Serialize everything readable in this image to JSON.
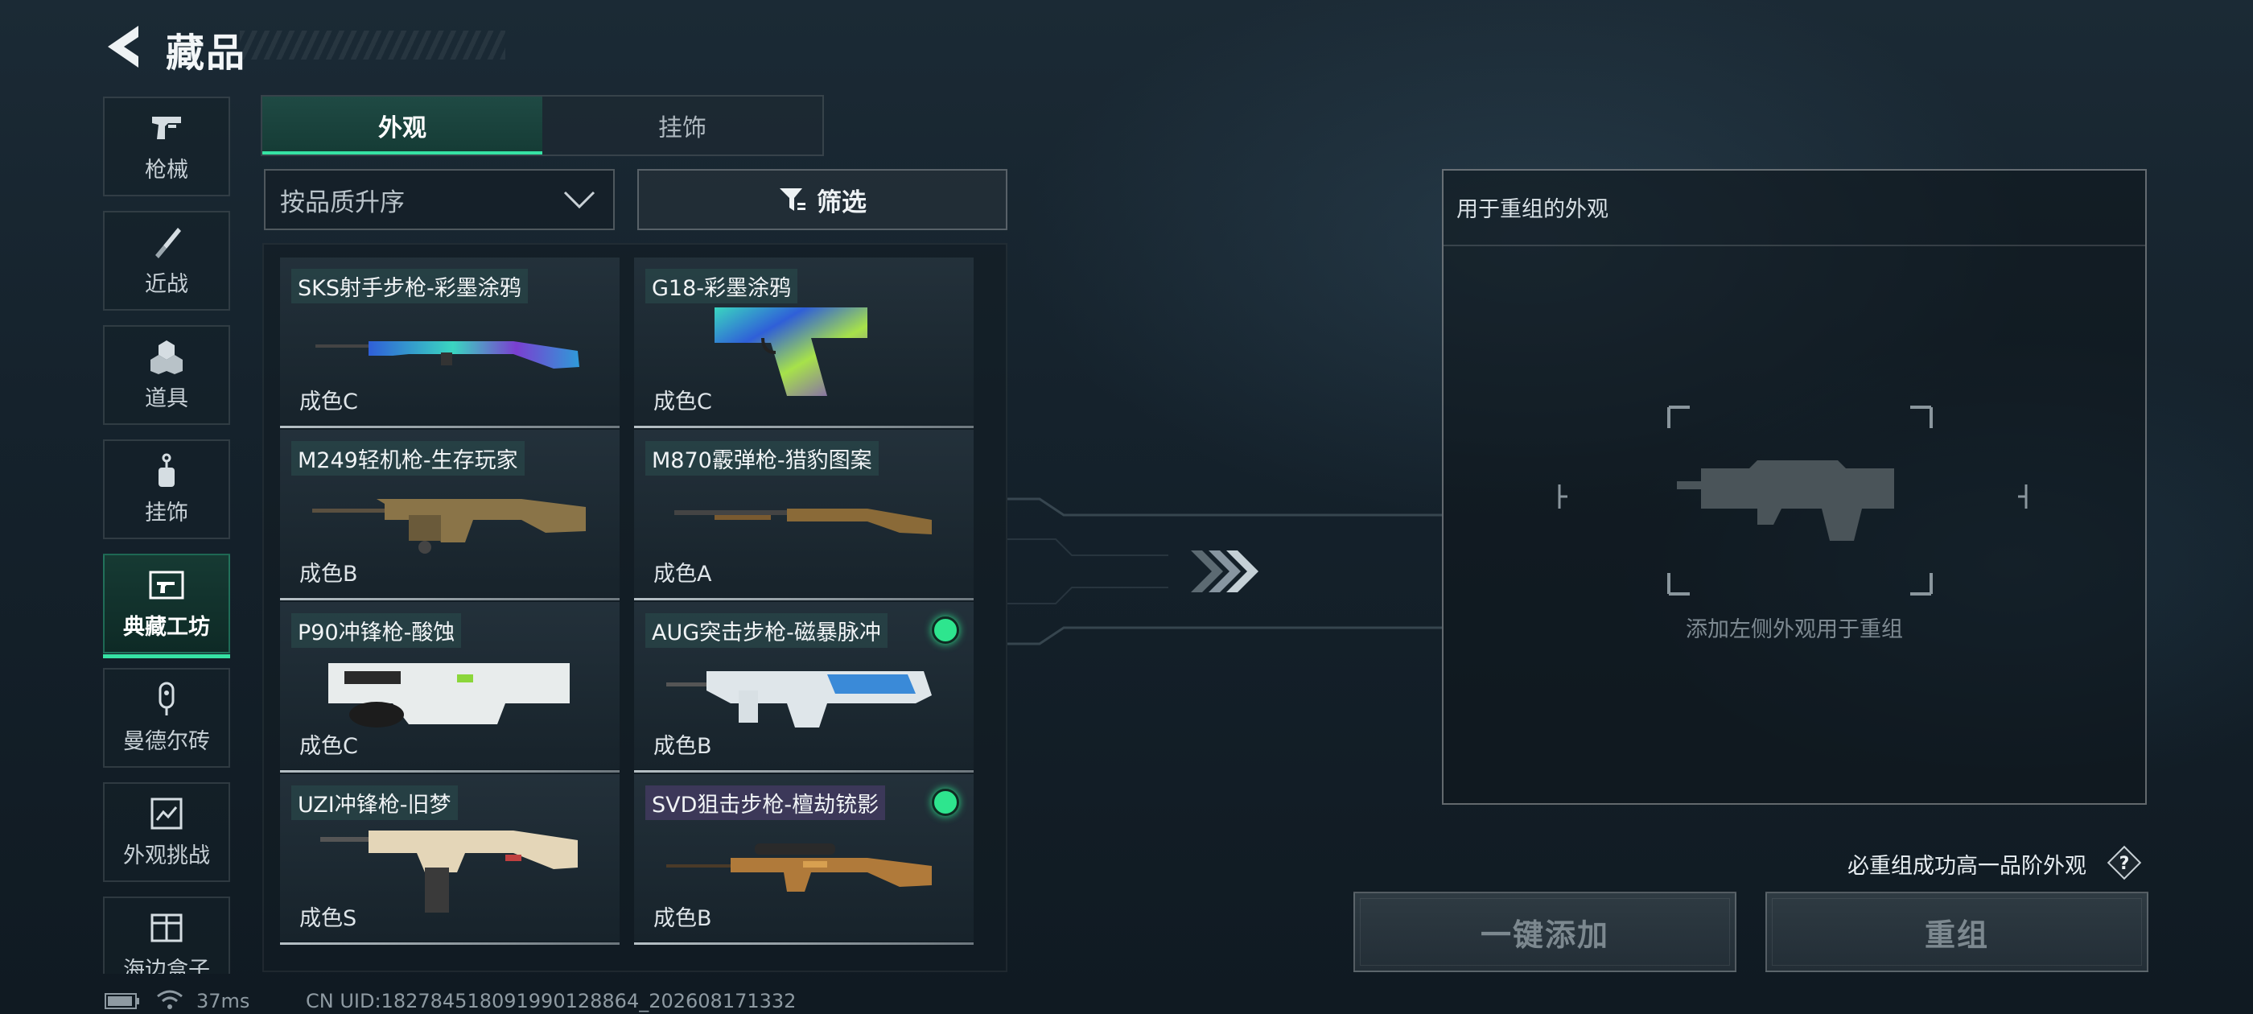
{
  "header": {
    "title": "藏品",
    "back_icon": "back-arrow-icon"
  },
  "nav": {
    "items": [
      {
        "label": "枪械",
        "icon": "pistol-icon"
      },
      {
        "label": "近战",
        "icon": "knife-icon"
      },
      {
        "label": "道具",
        "icon": "cubes-icon"
      },
      {
        "label": "挂饰",
        "icon": "charm-icon"
      },
      {
        "label": "典藏工坊",
        "icon": "workshop-icon",
        "active": true
      },
      {
        "label": "曼德尔砖",
        "icon": "brick-icon"
      },
      {
        "label": "外观挑战",
        "icon": "challenge-icon"
      },
      {
        "label": "海边盒子",
        "icon": "box-icon"
      }
    ]
  },
  "tabs": [
    {
      "label": "外观",
      "active": true
    },
    {
      "label": "挂饰",
      "active": false
    }
  ],
  "sort": {
    "label": "按品质升序"
  },
  "filter": {
    "label": "筛选"
  },
  "items": [
    {
      "name": "SKS射手步枪-彩墨涂鸦",
      "grade": "成色C",
      "new": false
    },
    {
      "name": "G18-彩墨涂鸦",
      "grade": "成色C",
      "new": false
    },
    {
      "name": "M249轻机枪-生存玩家",
      "grade": "成色B",
      "new": false
    },
    {
      "name": "M870霰弹枪-猎豹图案",
      "grade": "成色A",
      "new": false
    },
    {
      "name": "P90冲锋枪-酸蚀",
      "grade": "成色C",
      "new": false
    },
    {
      "name": "AUG突击步枪-磁暴脉冲",
      "grade": "成色B",
      "new": true
    },
    {
      "name": "UZI冲锋枪-旧梦",
      "grade": "成色S",
      "new": false
    },
    {
      "name": "SVD狙击步枪-檀劫铳影",
      "grade": "成色B",
      "new": true
    }
  ],
  "recombine": {
    "title": "用于重组的外观",
    "placeholder": "添加左侧外观用于重组",
    "guarantee": "必重组成功高一品阶外观",
    "add_button": "一键添加",
    "recombine_button": "重组"
  },
  "status": {
    "ping": "37ms",
    "uid": "CN UID:1827845180919901288​64_202608171332"
  },
  "colors": {
    "accent": "#36e2a4",
    "new_dot": "#2ee58e"
  }
}
